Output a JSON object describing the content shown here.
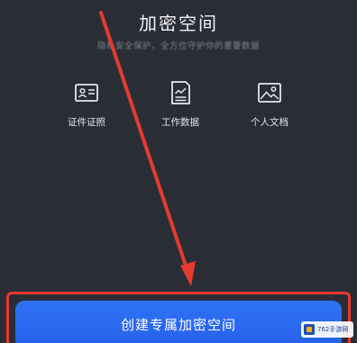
{
  "header": {
    "title": "加密空间",
    "subtitle": "隐私安全保护，全方位守护你的重要数据"
  },
  "features": [
    {
      "label": "证件证照",
      "icon": "id-card-icon"
    },
    {
      "label": "工作数据",
      "icon": "document-chart-icon"
    },
    {
      "label": "个人文档",
      "icon": "image-icon"
    }
  ],
  "cta": {
    "label": "创建专属加密空间"
  },
  "annotation": {
    "arrow_color": "#e53a2f",
    "highlight_color": "#e53a2f"
  },
  "watermark": {
    "text": "762手游网"
  },
  "colors": {
    "background": "#2b2d36",
    "button": "#2f72f5"
  }
}
